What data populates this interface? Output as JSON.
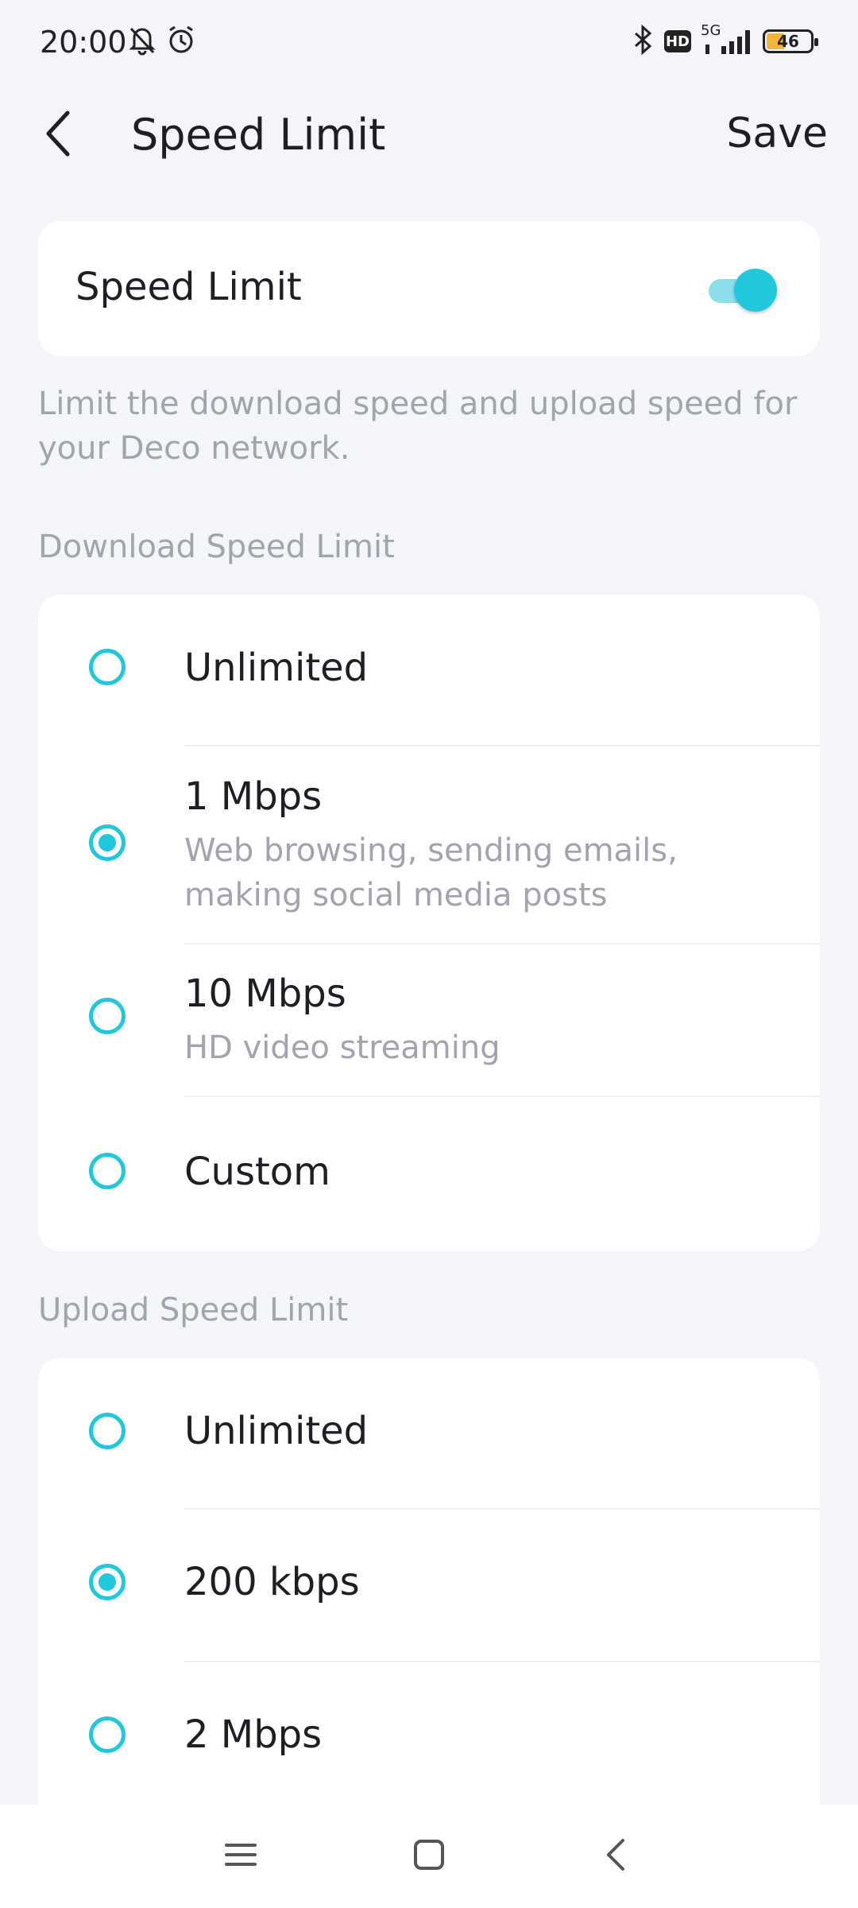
{
  "status_bar": {
    "time": "20:00",
    "battery": "46",
    "network": "5G",
    "hd_label": "HD",
    "icons": [
      "mute-bell-icon",
      "alarm-icon",
      "bluetooth-icon",
      "hd-icon",
      "signal-icon",
      "battery-icon"
    ]
  },
  "header": {
    "title": "Speed Limit",
    "save_label": "Save",
    "back_icon": "chevron-left-icon"
  },
  "toggle": {
    "label": "Speed Limit",
    "enabled": true
  },
  "description": "Limit the download speed and upload speed for your Deco network.",
  "download": {
    "label": "Download Speed Limit",
    "options": [
      {
        "title": "Unlimited",
        "subtitle": "",
        "selected": false
      },
      {
        "title": "1 Mbps",
        "subtitle": "Web browsing, sending emails, making social media posts",
        "selected": true
      },
      {
        "title": "10 Mbps",
        "subtitle": "HD video streaming",
        "selected": false
      },
      {
        "title": "Custom",
        "subtitle": "",
        "selected": false
      }
    ]
  },
  "upload": {
    "label": "Upload Speed Limit",
    "options": [
      {
        "title": "Unlimited",
        "selected": false
      },
      {
        "title": "200 kbps",
        "selected": true
      },
      {
        "title": "2 Mbps",
        "selected": false
      }
    ]
  },
  "nav": {
    "icons": [
      "menu-icon",
      "home-square-icon",
      "back-icon"
    ]
  },
  "colors": {
    "accent": "#1fc8dd",
    "background": "#f4f5f9",
    "secondary_text": "#a2a4ad"
  }
}
